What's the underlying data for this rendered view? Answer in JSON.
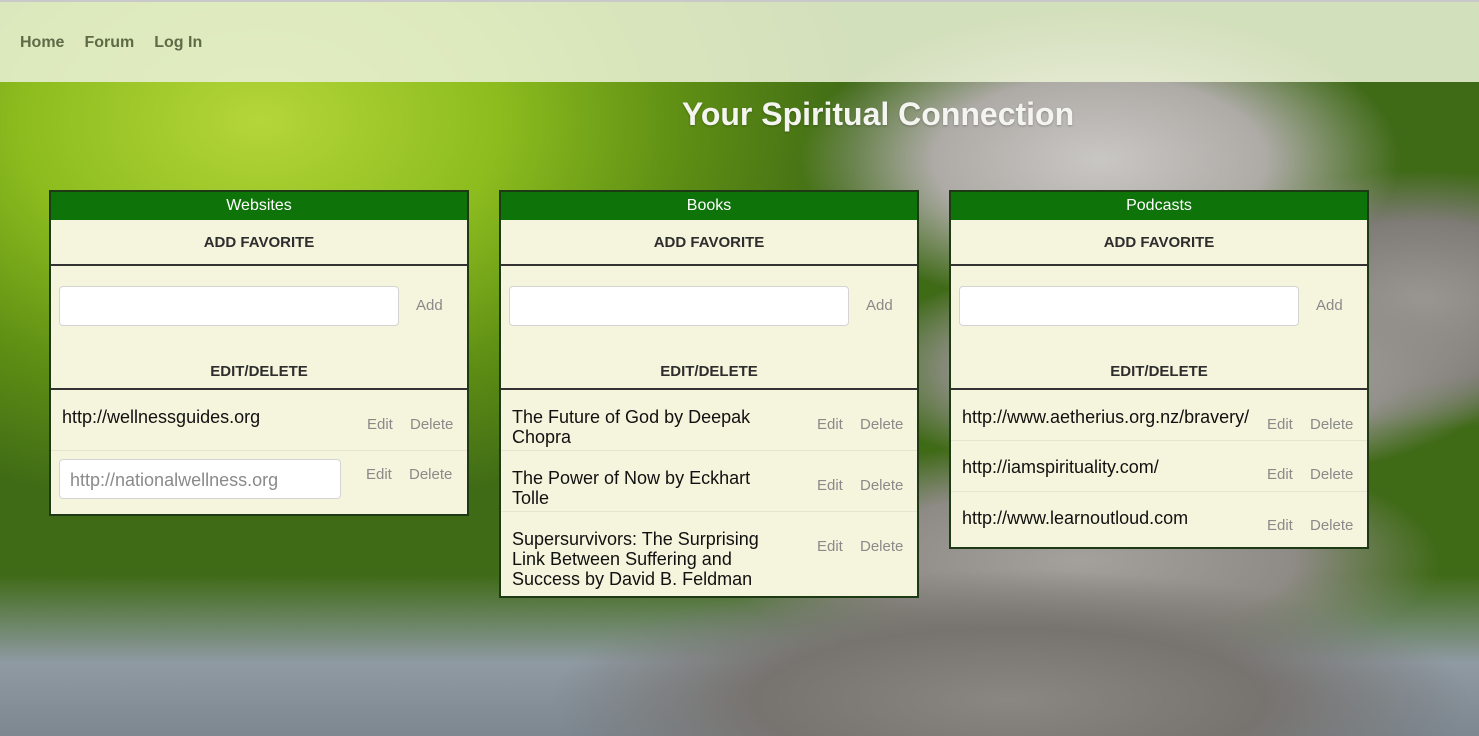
{
  "nav": {
    "home": "Home",
    "forum": "Forum",
    "login": "Log In"
  },
  "page_title": "Your Spiritual Connection",
  "panels": [
    {
      "title": "Websites",
      "add_title": "ADD FAVORITE",
      "add_button": "Add",
      "edit_title": "EDIT/DELETE",
      "items": [
        {
          "text": "http://wellnessguides.org",
          "edit": "Edit",
          "delete": "Delete"
        },
        {
          "text": "http://nationalwellness.org",
          "edit": "Edit",
          "delete": "Delete",
          "editing": true
        }
      ]
    },
    {
      "title": "Books",
      "add_title": "ADD FAVORITE",
      "add_button": "Add",
      "edit_title": "EDIT/DELETE",
      "items": [
        {
          "text": "The Future of God by Deepak Chopra",
          "edit": "Edit",
          "delete": "Delete"
        },
        {
          "text": "The Power of Now by Eckhart Tolle",
          "edit": "Edit",
          "delete": "Delete"
        },
        {
          "text": "Supersurvivors: The Surprising Link Between Suffering and Success by David B. Feldman",
          "edit": "Edit",
          "delete": "Delete"
        }
      ]
    },
    {
      "title": "Podcasts",
      "add_title": "ADD FAVORITE",
      "add_button": "Add",
      "edit_title": "EDIT/DELETE",
      "items": [
        {
          "text": "http://www.aetherius.org.nz/bravery/",
          "edit": "Edit",
          "delete": "Delete"
        },
        {
          "text": "http://iamspirituality.com/",
          "edit": "Edit",
          "delete": "Delete"
        },
        {
          "text": "http://www.learnoutloud.com",
          "edit": "Edit",
          "delete": "Delete"
        }
      ]
    }
  ]
}
